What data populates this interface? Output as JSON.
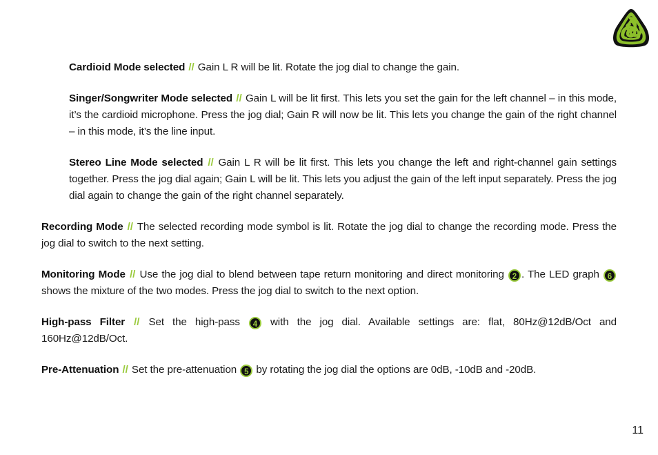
{
  "document": {
    "page_number": "11",
    "accent_color": "#9ACA3C",
    "separator": "//",
    "logo": {
      "icon_name": "triskelion-triangle-logo",
      "color": "#9ACA3C",
      "outline_color": "#111111"
    }
  },
  "paragraphs": [
    {
      "id": "cardioid-mode",
      "indented": true,
      "lead": "Cardioid Mode selected",
      "body_parts": [
        {
          "type": "text",
          "value": " Gain L R will be lit. Rotate the jog dial to change the gain."
        }
      ]
    },
    {
      "id": "singer-songwriter-mode",
      "indented": true,
      "lead": "Singer/Songwriter Mode selected",
      "body_parts": [
        {
          "type": "text",
          "value": " Gain L will be lit first. This lets you set the gain for the left channel – in this mode, it’s the cardioid microphone. Press the jog dial; Gain R will now be lit. This lets you change the gain of the right channel – in this mode, it’s the line input."
        }
      ]
    },
    {
      "id": "stereo-line-mode",
      "indented": true,
      "lead": "Stereo Line Mode selected",
      "body_parts": [
        {
          "type": "text",
          "value": " Gain L R will be lit first. This lets you change the left and right-channel gain settings together. Press the jog dial again; Gain L will be lit. This lets you adjust the gain of the left input separately. Press the jog dial again to change the gain of the right channel separately."
        }
      ]
    },
    {
      "id": "recording-mode",
      "indented": false,
      "lead": "Recording Mode",
      "body_parts": [
        {
          "type": "text",
          "value": " The selected recording mode symbol is lit. Rotate the jog dial to change the recording mode. Press the jog dial to switch to the next setting."
        }
      ]
    },
    {
      "id": "monitoring-mode",
      "indented": false,
      "lead": "Monitoring Mode",
      "body_parts": [
        {
          "type": "text",
          "value": " Use the jog dial to blend between tape return monitoring and direct monitoring "
        },
        {
          "type": "badge",
          "value": "2"
        },
        {
          "type": "text",
          "value": ". The LED graph "
        },
        {
          "type": "badge",
          "value": "6"
        },
        {
          "type": "text",
          "value": " shows the mixture of the two modes. Press the jog dial to switch to the next option."
        }
      ]
    },
    {
      "id": "high-pass-filter",
      "indented": false,
      "lead": "High-pass Filter",
      "body_parts": [
        {
          "type": "text",
          "value": " Set the high-pass "
        },
        {
          "type": "badge",
          "value": "4"
        },
        {
          "type": "text",
          "value": " with the jog dial. Available settings are: flat, 80Hz@12dB/Oct and 160Hz@12dB/Oct."
        }
      ]
    },
    {
      "id": "pre-attenuation",
      "indented": false,
      "lead": "Pre-Attenuation",
      "body_parts": [
        {
          "type": "text",
          "value": " Set the pre-attenuation "
        },
        {
          "type": "badge",
          "value": "5"
        },
        {
          "type": "text",
          "value": " by rotating the jog dial the options are 0dB, -10dB and -20dB."
        }
      ]
    }
  ]
}
